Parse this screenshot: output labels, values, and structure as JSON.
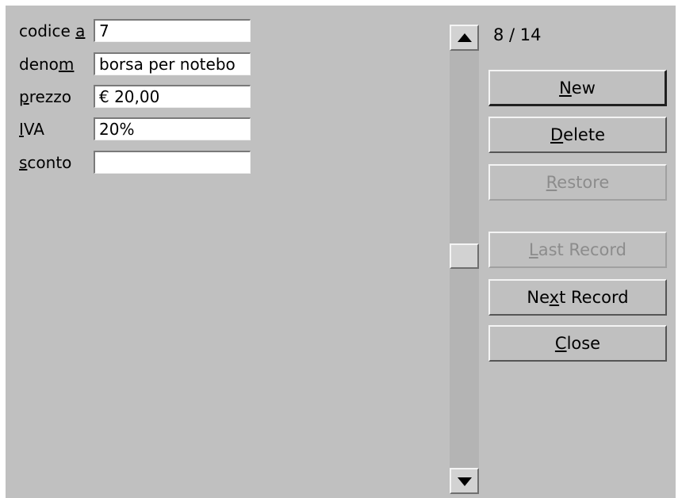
{
  "form": {
    "fields": [
      {
        "label_pre": "codice ",
        "label_mn": "a",
        "label_post": "",
        "value": "7"
      },
      {
        "label_pre": "deno",
        "label_mn": "m",
        "label_post": "",
        "value": "borsa per notebo"
      },
      {
        "label_pre": "",
        "label_mn": "p",
        "label_post": "rezzo",
        "value": "€ 20,00"
      },
      {
        "label_pre": "",
        "label_mn": "I",
        "label_post": "VA",
        "value": "20%"
      },
      {
        "label_pre": "",
        "label_mn": "s",
        "label_post": "conto",
        "value": ""
      }
    ]
  },
  "navigator": {
    "record_counter": "8 / 14",
    "current_record": 8,
    "total_records": 14
  },
  "buttons": {
    "new": {
      "pre": "",
      "mn": "N",
      "post": "ew",
      "enabled": true
    },
    "delete": {
      "pre": "",
      "mn": "D",
      "post": "elete",
      "enabled": true
    },
    "restore": {
      "pre": "",
      "mn": "R",
      "post": "estore",
      "enabled": false
    },
    "last": {
      "pre": "",
      "mn": "L",
      "post": "ast Record",
      "enabled": false
    },
    "next": {
      "pre": "Ne",
      "mn": "x",
      "post": "t Record",
      "enabled": true
    },
    "close": {
      "pre": "",
      "mn": "C",
      "post": "lose",
      "enabled": true
    }
  },
  "icons": {
    "scroll_up": "triangle-up-icon",
    "scroll_down": "triangle-down-icon"
  },
  "colors": {
    "window_bg": "#c0c0c0",
    "field_bg": "#ffffff",
    "disabled_text": "#8c8c8c"
  }
}
